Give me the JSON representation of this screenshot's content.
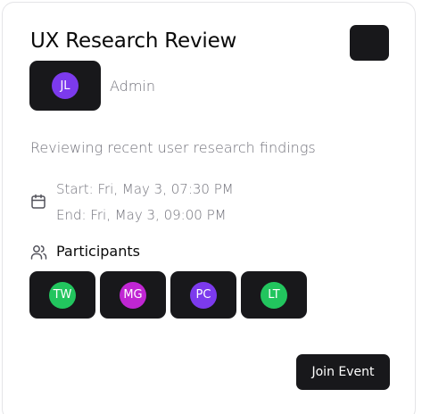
{
  "event": {
    "title": "UX Research Review",
    "organizer": {
      "initials": "JL",
      "role": "Admin",
      "color": "#7c3aed"
    },
    "description": "Reviewing recent user research findings",
    "start": "Start: Fri, May 3, 07:30 PM",
    "end": "End: Fri, May 3, 09:00 PM",
    "participants_heading": "Participants",
    "participants": [
      {
        "initials": "TW",
        "color": "#22c55e"
      },
      {
        "initials": "MG",
        "color": "#c026d3"
      },
      {
        "initials": "PC",
        "color": "#7c3aed"
      },
      {
        "initials": "LT",
        "color": "#22c55e"
      }
    ],
    "join_label": "Join Event"
  },
  "icons": {
    "menu": "more-options-icon",
    "calendar": "calendar-icon",
    "participants": "users-icon"
  }
}
